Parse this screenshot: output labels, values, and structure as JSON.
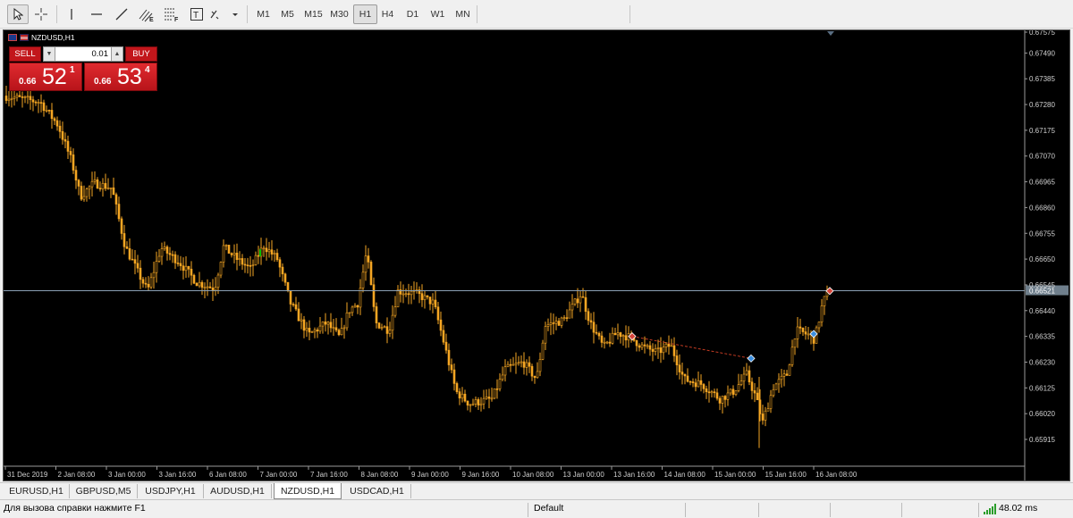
{
  "toolbar": {
    "tools": [
      {
        "name": "cursor-icon"
      },
      {
        "name": "crosshair-icon"
      },
      {
        "name": "vertical-line-icon"
      },
      {
        "name": "horizontal-line-icon"
      },
      {
        "name": "trend-line-icon"
      },
      {
        "name": "equidistant-channel-icon"
      },
      {
        "name": "fibonacci-icon"
      },
      {
        "name": "text-label-icon"
      },
      {
        "name": "shapes-icon"
      }
    ],
    "timeframes": [
      "M1",
      "M5",
      "M15",
      "M30",
      "H1",
      "H4",
      "D1",
      "W1",
      "MN"
    ],
    "active_timeframe": "H1"
  },
  "chart": {
    "symbol_title": "NZDUSD,H1",
    "background": "#000000",
    "candle_color": "#f5a623",
    "up_tick_color": "#00c000",
    "bid_line_color": "#8aa0b4",
    "trade_line_color": "#c23b22",
    "price_axis_labels": [
      "0.67575",
      "0.67490",
      "0.67385",
      "0.67280",
      "0.67175",
      "0.67070",
      "0.66965",
      "0.66860",
      "0.66755",
      "0.66650",
      "0.66545",
      "0.66440",
      "0.66335",
      "0.66230",
      "0.66125",
      "0.66020",
      "0.65915"
    ],
    "current_price_label": "0.66521",
    "time_axis_labels": [
      "31 Dec 2019",
      "2 Jan 08:00",
      "3 Jan 00:00",
      "3 Jan 16:00",
      "6 Jan 08:00",
      "7 Jan 00:00",
      "7 Jan 16:00",
      "8 Jan 08:00",
      "9 Jan 00:00",
      "9 Jan 16:00",
      "10 Jan 08:00",
      "13 Jan 00:00",
      "13 Jan 16:00",
      "14 Jan 08:00",
      "15 Jan 00:00",
      "15 Jan 16:00",
      "16 Jan 08:00"
    ]
  },
  "trade_panel": {
    "sell_label": "SELL",
    "buy_label": "BUY",
    "lot_value": "0.01",
    "sell_price": {
      "small": "0.66",
      "big": "52",
      "sup": "1"
    },
    "buy_price": {
      "small": "0.66",
      "big": "53",
      "sup": "4"
    }
  },
  "tabs": [
    "EURUSD,H1",
    "GBPUSD,M5",
    "USDJPY,H1",
    "AUDUSD,H1",
    "NZDUSD,H1",
    "USDCAD,H1"
  ],
  "active_tab": "NZDUSD,H1",
  "status": {
    "help_text": "Для вызова справки нажмите F1",
    "profile": "Default",
    "ping": "48.02 ms"
  }
}
